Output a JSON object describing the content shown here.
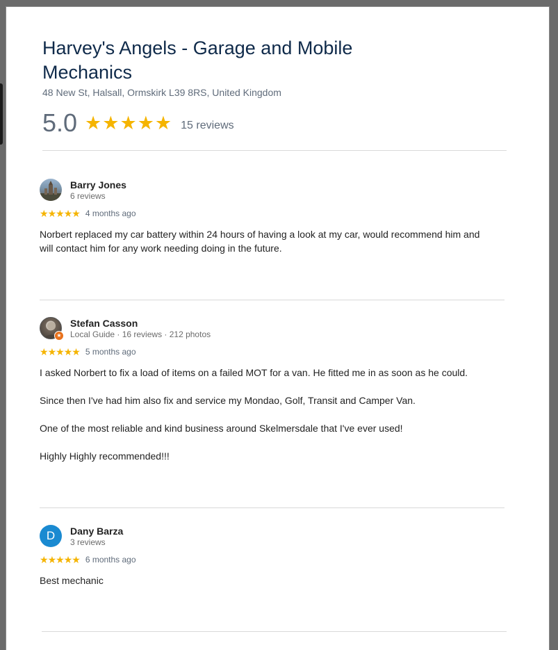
{
  "business": {
    "name": "Harvey's Angels - Garage and Mobile Mechanics",
    "address": "48 New St, Halsall, Ormskirk L39 8RS, United Kingdom",
    "rating": "5.0",
    "rating_stars": 5,
    "review_count": "15 reviews"
  },
  "colors": {
    "star": "#f5b400",
    "title": "#0f2a4a",
    "avatar_letter_bg": "#1a8ad1",
    "local_guide_badge": "#e8711c"
  },
  "reviews": [
    {
      "reviewer": "Barry Jones",
      "meta": "6 reviews",
      "avatar": "photo-avatar",
      "stars": 5,
      "date": "4 months ago",
      "paragraphs": [
        "Norbert replaced my car battery within 24 hours of having a look at my car, would recommend him and will contact him for any work needing doing in the future."
      ]
    },
    {
      "reviewer": "Stefan Casson",
      "meta": "Local Guide · 16 reviews · 212 photos",
      "avatar": "photo-avatar",
      "local_guide": true,
      "stars": 5,
      "date": "5 months ago",
      "paragraphs": [
        "I asked Norbert to fix a load of items on a failed MOT for a van. He fitted me in as soon as he could.",
        "Since then I've had him also fix and service my Mondao, Golf, Transit and Camper Van.",
        "One of the most reliable and kind business around Skelmersdale that I've ever used!",
        "Highly Highly recommended!!!"
      ]
    },
    {
      "reviewer": "Dany Barza",
      "meta": "3 reviews",
      "avatar": "letter-avatar",
      "avatar_letter": "D",
      "stars": 5,
      "date": "6 months ago",
      "paragraphs": [
        "Best mechanic"
      ]
    }
  ]
}
